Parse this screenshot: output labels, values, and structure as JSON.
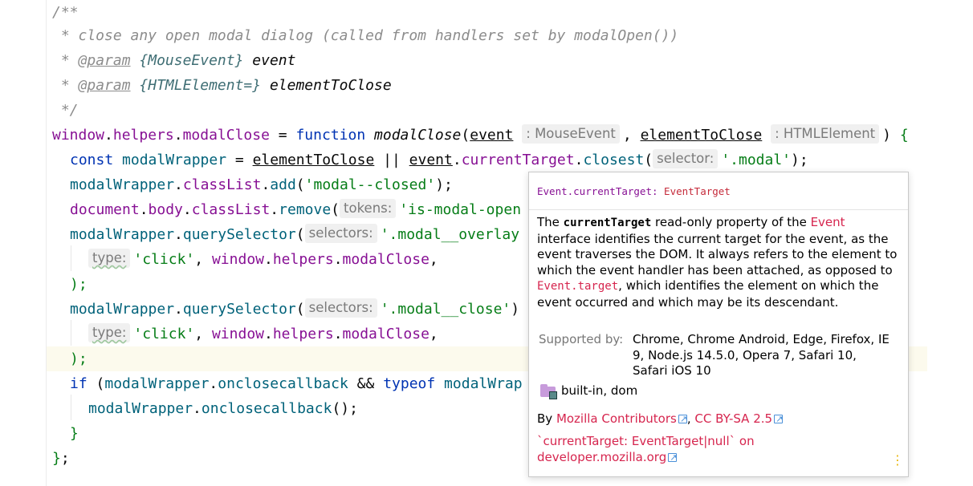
{
  "editor": {
    "lines": {
      "l1": {
        "open": "/**"
      },
      "l2": {
        "text": " * close any open modal dialog (called from handlers set by modalOpen())"
      },
      "l3": {
        "star": " * ",
        "tag": "@param",
        "type": "{MouseEvent}",
        "name": " event"
      },
      "l4": {
        "star": " * ",
        "tag": "@param",
        "type": "{HTMLElement=}",
        "name": " elementToClose"
      },
      "l5": {
        "close": " */"
      },
      "l6": {
        "window": "window",
        "dot1": ".",
        "helpers": "helpers",
        "dot2": ".",
        "modalClose": "modalClose",
        "eq": " = ",
        "function": "function",
        "space": " ",
        "fname": "modalClose",
        "paren": "(",
        "p1": "event",
        "h1": ": MouseEvent",
        "comma": ", ",
        "p2": "elementToClose",
        "h2": ": HTMLElement",
        "end": ") ",
        "brace": "{"
      },
      "l7": {
        "const": "const",
        "var": " modalWrapper",
        "eq": " = ",
        "p2": "elementToClose",
        "or": " || ",
        "p1": "event",
        "dot": ".",
        "prop": "currentTarget",
        "dot2": ".",
        "method": "closest",
        "paren": "(",
        "hint": "selector:",
        "str": "'.modal'",
        "end": ");"
      },
      "l8": {
        "var": "modalWrapper",
        "dot": ".",
        "prop": "classList",
        "dot2": ".",
        "method": "add",
        "paren": "(",
        "str": "'modal--closed'",
        "end": ");"
      },
      "l9": {
        "document": "document",
        "dot": ".",
        "body": "body",
        "dot2": ".",
        "prop": "classList",
        "dot3": ".",
        "method": "remove",
        "paren": "(",
        "hint": "tokens:",
        "str": "'is-modal-open"
      },
      "l10": {
        "var": "modalWrapper",
        "dot": ".",
        "method": "querySelector",
        "paren": "(",
        "hint": "selectors:",
        "str": "'.modal__overlay"
      },
      "l11": {
        "hint": "type:",
        "str": "'click'",
        "comma": ", ",
        "window": "window",
        "dot1": ".",
        "helpers": "helpers",
        "dot2": ".",
        "modalClose": "modalClose",
        "end": ","
      },
      "l12": {
        "text": ");"
      },
      "l13": {
        "var": "modalWrapper",
        "dot": ".",
        "method": "querySelector",
        "paren": "(",
        "hint": "selectors:",
        "str": "'.modal__close'",
        "end": ")"
      },
      "l14": {
        "hint": "type:",
        "str": "'click'",
        "comma": ", ",
        "window": "window",
        "dot1": ".",
        "helpers": "helpers",
        "dot2": ".",
        "modalClose": "modalClose",
        "end": ","
      },
      "l15": {
        "text": ");"
      },
      "l16": {
        "if": "if",
        "paren": " (",
        "var": "modalWrapper",
        "dot": ".",
        "prop": "onclosecallback",
        "and": " && ",
        "typeof": "typeof",
        "var2": " modalWrap"
      },
      "l17": {
        "var": "modalWrapper",
        "dot": ".",
        "prop": "onclosecallback",
        "end": "();"
      },
      "l18": {
        "text": "}"
      },
      "l19": {
        "brace": "}",
        "semi": ";"
      }
    }
  },
  "popup": {
    "definition": {
      "name": "Event.currentTarget:",
      "type": " EventTarget"
    },
    "description": {
      "p1": "The ",
      "code1": "currentTarget",
      "p2": " read-only property of the ",
      "link1": "Event",
      "p3": " interface identifies the current target for the event, as the event traverses the DOM. It always refers to the element to which the event handler has been attached, as opposed to ",
      "link2": "Event.target",
      "p4": ", which identifies the element on which the event occurred and which may be its descendant."
    },
    "supported_label": "Supported by:",
    "supported_value": "Chrome, Chrome Android, Edge, Firefox, IE 9, Node.js 14.5.0, Opera 7, Safari 10, Safari iOS 10",
    "module": "built-in, dom",
    "by_label": "By ",
    "contributors": "Mozilla Contributors",
    "comma": ", ",
    "license": "CC BY-SA 2.5",
    "source_text": "`currentTarget: EventTarget|null` on",
    "source_link": "developer.mozilla.org",
    "more_glyph": "⋮",
    "colors": {
      "link": "#d6254e",
      "ext_icon": "#4a90d9",
      "more": "#e8b400"
    },
    "icons": [
      "folder-icon",
      "external-link-icon",
      "more-options-icon"
    ]
  }
}
